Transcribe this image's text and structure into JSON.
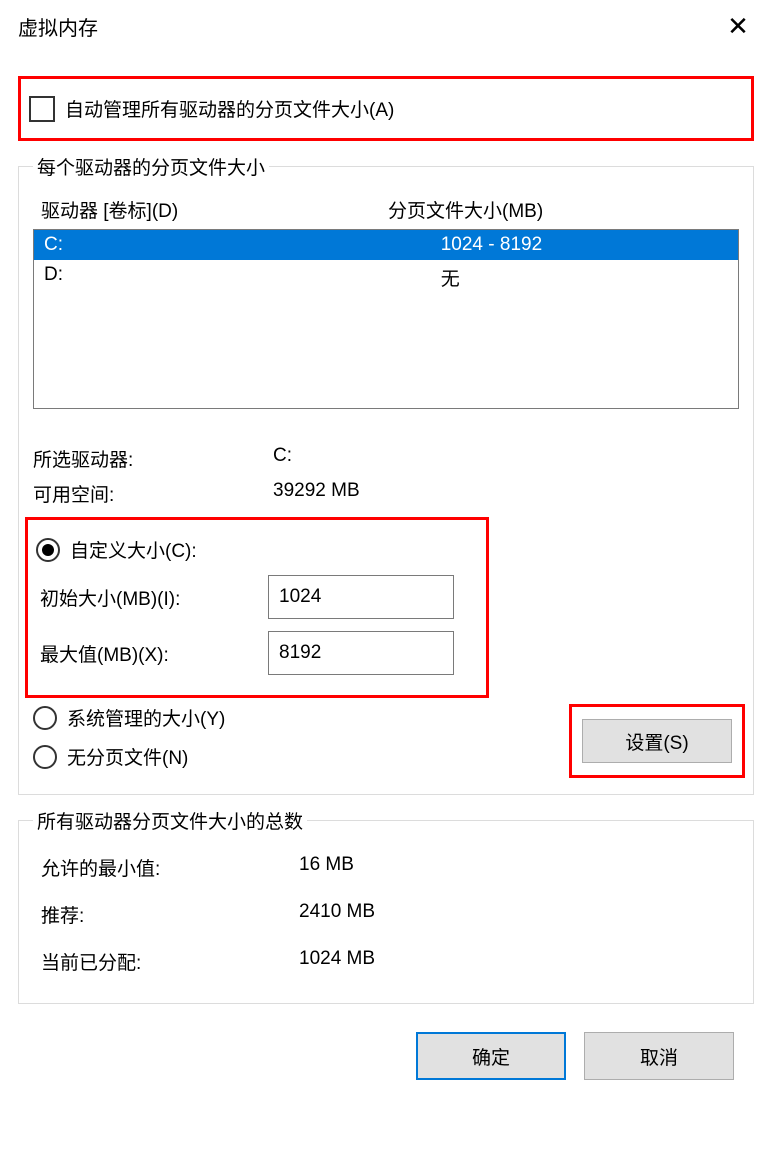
{
  "title": "虚拟内存",
  "auto_manage": {
    "label": "自动管理所有驱动器的分页文件大小(A)",
    "checked": false
  },
  "per_drive": {
    "legend": "每个驱动器的分页文件大小",
    "header_drive": "驱动器 [卷标](D)",
    "header_size": "分页文件大小(MB)",
    "rows": [
      {
        "drive": "C:",
        "size": "1024 - 8192",
        "selected": true
      },
      {
        "drive": "D:",
        "size": "无",
        "selected": false
      }
    ],
    "selected_drive_label": "所选驱动器:",
    "selected_drive_value": "C:",
    "free_space_label": "可用空间:",
    "free_space_value": "39292 MB"
  },
  "size_options": {
    "custom_label": "自定义大小(C):",
    "initial_label": "初始大小(MB)(I):",
    "initial_value": "1024",
    "max_label": "最大值(MB)(X):",
    "max_value": "8192",
    "system_managed_label": "系统管理的大小(Y)",
    "no_paging_label": "无分页文件(N)",
    "set_button": "设置(S)",
    "selected": "custom"
  },
  "totals": {
    "legend": "所有驱动器分页文件大小的总数",
    "min_label": "允许的最小值:",
    "min_value": "16 MB",
    "rec_label": "推荐:",
    "rec_value": "2410 MB",
    "cur_label": "当前已分配:",
    "cur_value": "1024 MB"
  },
  "buttons": {
    "ok": "确定",
    "cancel": "取消"
  }
}
